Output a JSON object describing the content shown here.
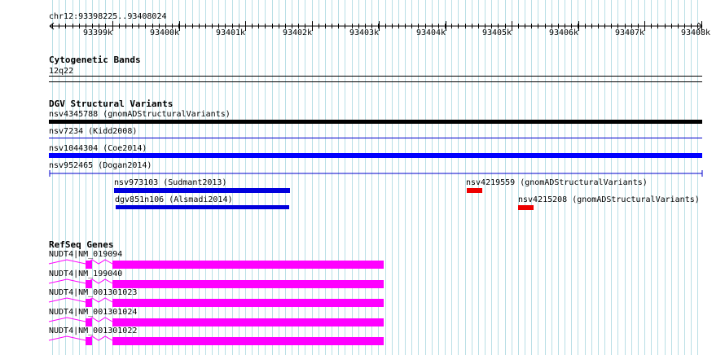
{
  "ruler": {
    "location": "chr12:93398225..93408024",
    "ticks": [
      "93399k",
      "93400k",
      "93401k",
      "93402k",
      "93403k",
      "93404k",
      "93405k",
      "93406k",
      "93407k",
      "93408k"
    ]
  },
  "tracks": {
    "cytoband": {
      "title": "Cytogenetic Bands",
      "band": "12q22"
    },
    "dgv": {
      "title": "DGV Structural Variants",
      "features": [
        {
          "label": "nsv4345788 (gnomADStructuralVariants)",
          "color": "#000000"
        },
        {
          "label": "nsv7234 (Kidd2008)",
          "color": "#0000cc"
        },
        {
          "label": "nsv1044304 (Coe2014)",
          "color": "#0000ff"
        },
        {
          "label": "nsv952465 (Dogan2014)",
          "color": "#0000cc"
        },
        {
          "label": "nsv973103 (Sudmant2013)",
          "color": "#0000dd"
        },
        {
          "label": "dgv851n106 (Alsmadi2014)",
          "color": "#0000dd"
        },
        {
          "label": "nsv4219559 (gnomADStructuralVariants)",
          "color": "#ee0000"
        },
        {
          "label": "nsv4215208 (gnomADStructuralVariants)",
          "color": "#ee0000"
        }
      ]
    },
    "refseq": {
      "title": "RefSeq Genes",
      "color": "#ff00ff",
      "transcripts": [
        {
          "label": "NUDT4|NM_019094"
        },
        {
          "label": "NUDT4|NM_199040"
        },
        {
          "label": "NUDT4|NM_001301023"
        },
        {
          "label": "NUDT4|NM_001301024"
        },
        {
          "label": "NUDT4|NM_001301022"
        }
      ]
    }
  }
}
